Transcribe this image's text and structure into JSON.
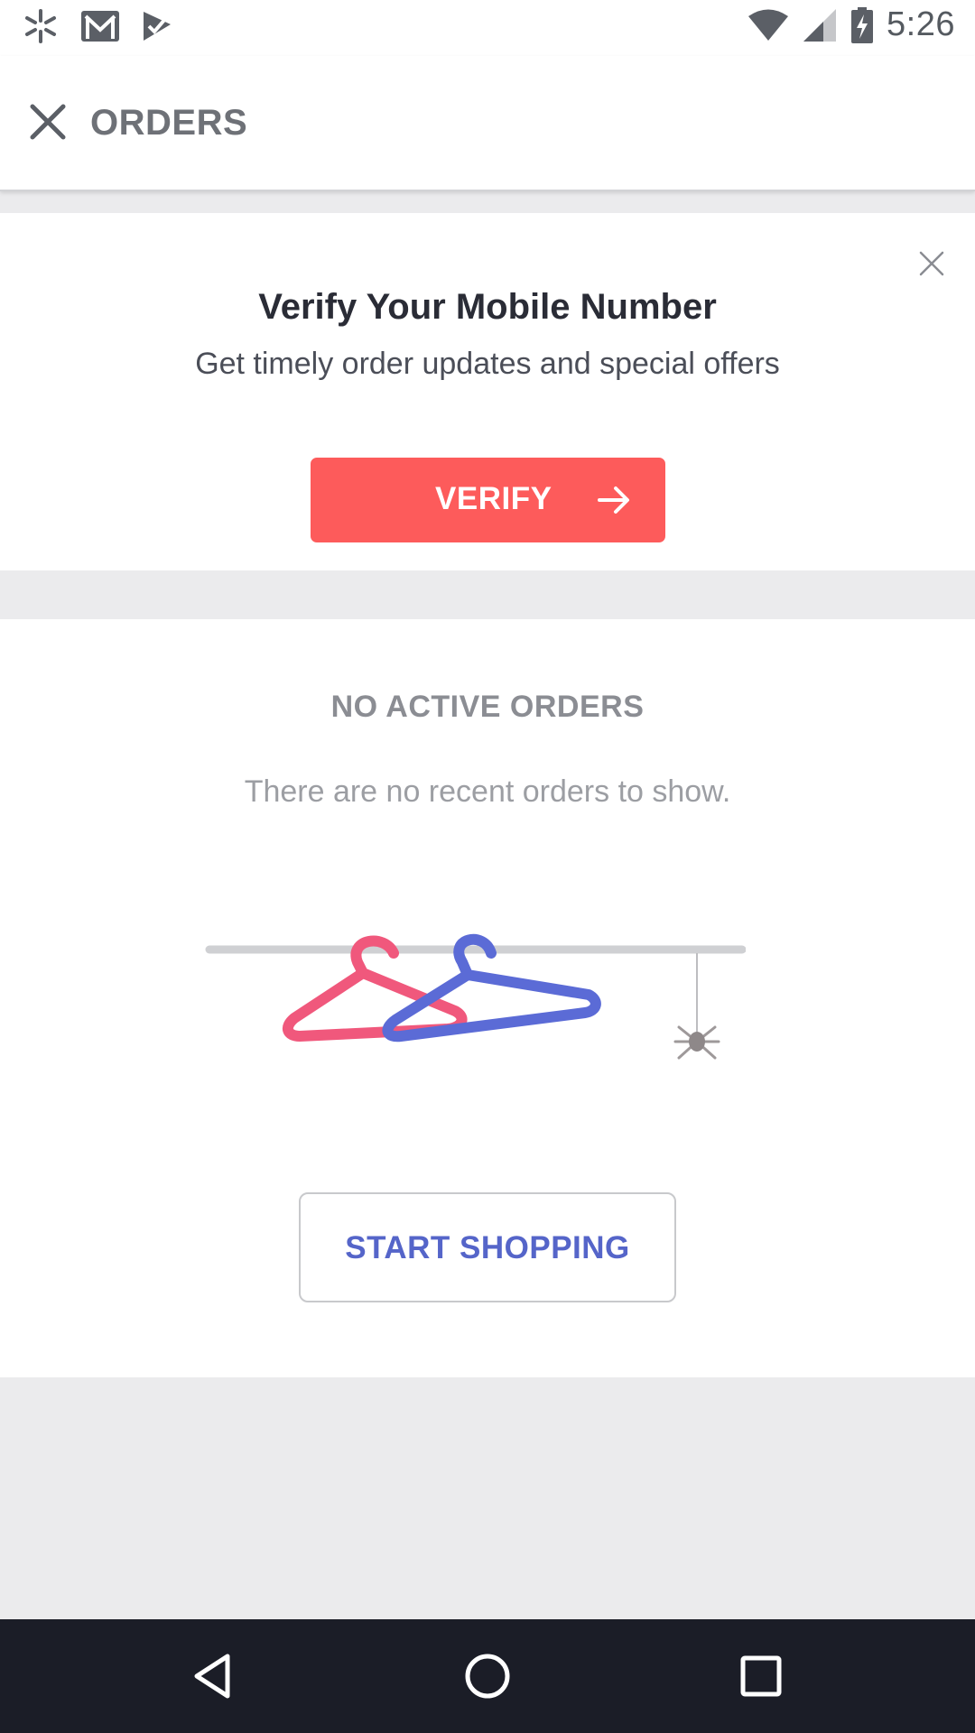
{
  "status_bar": {
    "time": "5:26",
    "left_icons": [
      "walmart-spark-icon",
      "gmail-icon",
      "checkmark-app-icon"
    ],
    "right_icons": [
      "wifi-icon",
      "cell-signal-icon",
      "battery-charging-icon"
    ]
  },
  "app_bar": {
    "title": "ORDERS",
    "close_icon": "close-icon"
  },
  "verify_card": {
    "heading": "Verify Your Mobile Number",
    "subtext": "Get timely order updates and special offers",
    "button_label": "VERIFY",
    "button_color": "#fd5b5b"
  },
  "orders": {
    "heading": "NO ACTIVE ORDERS",
    "subtext": "There are no recent orders to show.",
    "illustration_icons": [
      "clothes-rail-icon",
      "pink-hanger-icon",
      "blue-hanger-icon",
      "spider-icon"
    ],
    "button_label": "START SHOPPING",
    "accent_color": "#5565c9"
  },
  "nav_bar": {
    "icons": [
      "back-triangle-icon",
      "home-circle-icon",
      "recents-square-icon"
    ]
  }
}
